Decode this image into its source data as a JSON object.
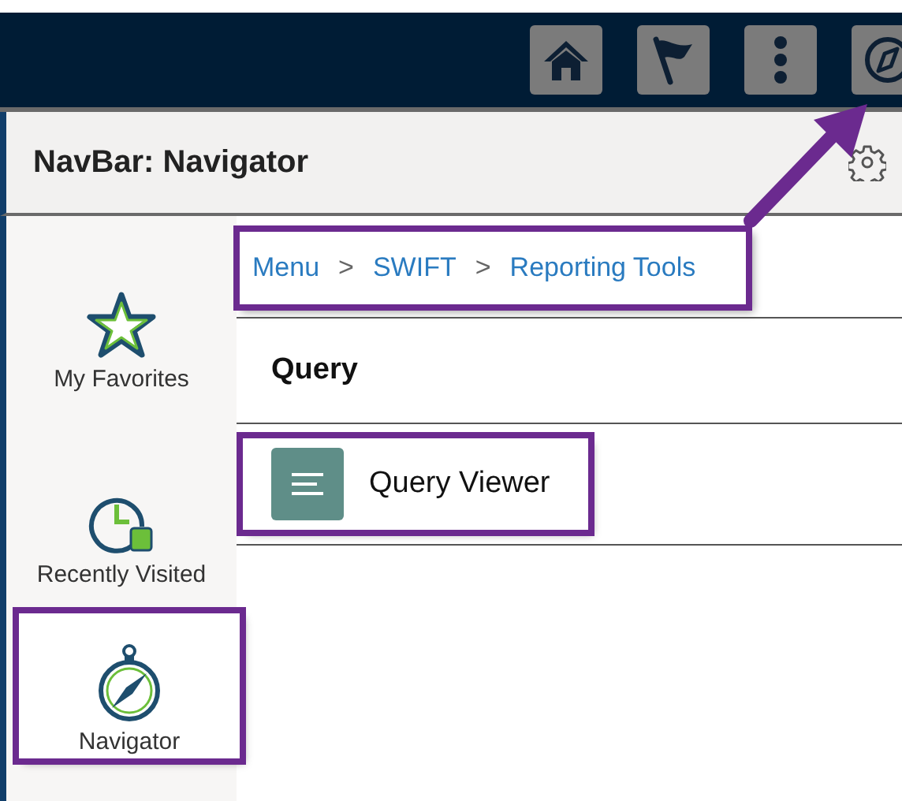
{
  "top_bar": {
    "buttons": [
      {
        "kind": "home"
      },
      {
        "kind": "flag"
      },
      {
        "kind": "more"
      },
      {
        "kind": "compass",
        "highlighted": true
      }
    ]
  },
  "header": {
    "title": "NavBar: Navigator"
  },
  "sidebar": {
    "items": [
      {
        "label": "My Favorites",
        "kind": "star",
        "selected": false,
        "highlighted": false
      },
      {
        "label": "Recently Visited",
        "kind": "clock",
        "selected": false,
        "highlighted": false
      },
      {
        "label": "Navigator",
        "kind": "compass",
        "selected": true,
        "highlighted": true
      }
    ]
  },
  "breadcrumbs": {
    "highlighted": true,
    "items": [
      {
        "kind": "link",
        "text": "Menu"
      },
      {
        "kind": "separator",
        "text": ">"
      },
      {
        "kind": "link",
        "text": "SWIFT"
      },
      {
        "kind": "separator",
        "text": ">"
      },
      {
        "kind": "link",
        "text": "Reporting Tools"
      }
    ]
  },
  "section": {
    "heading": "Query",
    "items": [
      {
        "label": "Query Viewer",
        "highlighted": true
      }
    ]
  }
}
